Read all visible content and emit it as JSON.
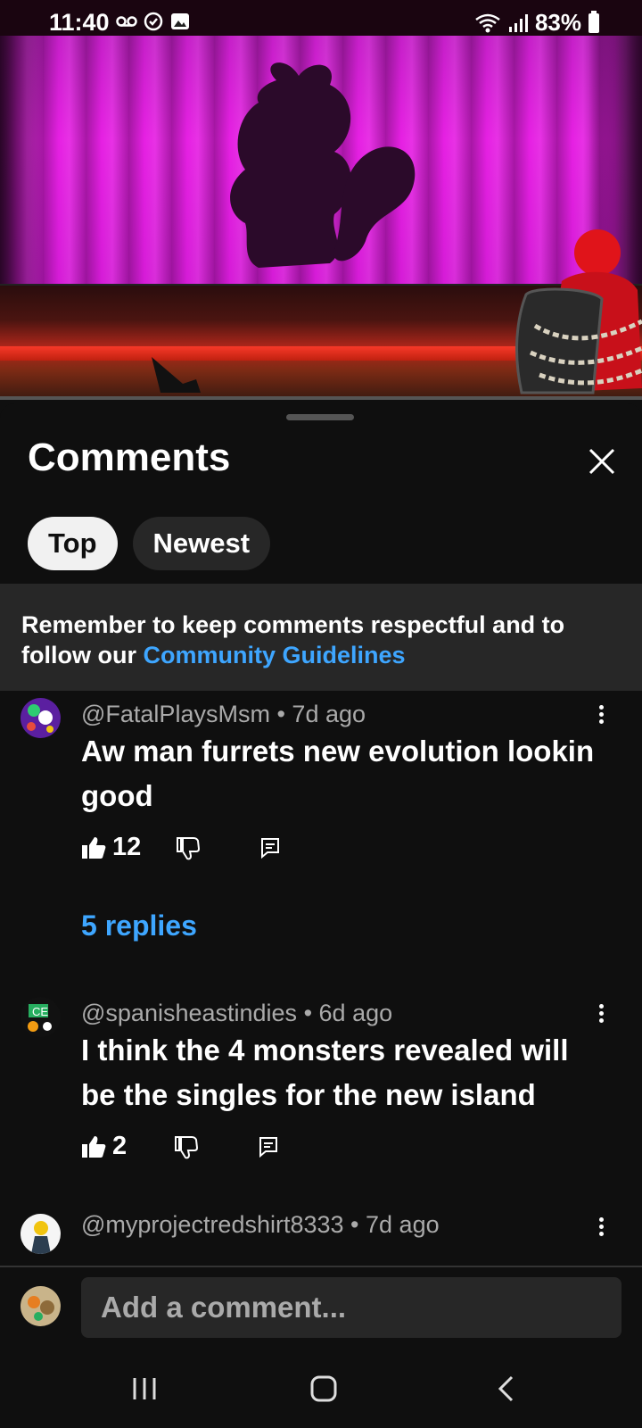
{
  "status_bar": {
    "time": "11:40",
    "battery": "83%",
    "icons": [
      "voicemail-icon",
      "sync-icon",
      "gallery-icon",
      "wifi-icon",
      "signal-icon",
      "battery-icon"
    ]
  },
  "sheet": {
    "title": "Comments",
    "close_icon": "close-icon",
    "tabs": [
      {
        "label": "Top",
        "active": true
      },
      {
        "label": "Newest",
        "active": false
      }
    ],
    "notice": {
      "text": "Remember to keep comments respectful and to follow our ",
      "link": "Community Guidelines"
    }
  },
  "comments": [
    {
      "author": "@FatalPlaysMsm",
      "time": "7d ago",
      "text": "Aw man furrets new evolution lookin good",
      "likes": "12",
      "replies": "5 replies"
    },
    {
      "author": "@spanisheastindies",
      "time": "6d ago",
      "text": "I think the 4 monsters revealed will be the singles for the new island",
      "likes": "2"
    },
    {
      "author": "@myprojectredshirt8333",
      "time": "7d ago"
    }
  ],
  "composer": {
    "placeholder": "Add a comment..."
  },
  "colors": {
    "background": "#0f0f0f",
    "surface": "#272727",
    "link": "#3ea6ff",
    "muted": "#aaaaaa",
    "curtain": "#e620e3"
  }
}
